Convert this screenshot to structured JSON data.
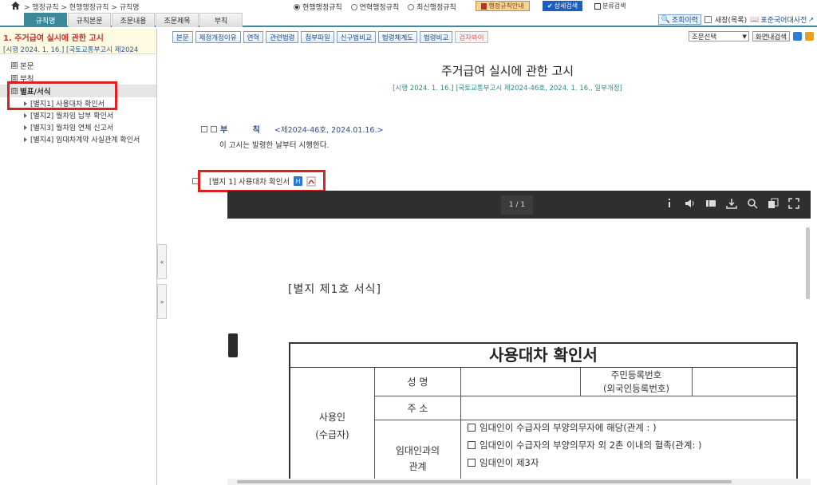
{
  "topbar": {
    "breadcrumb": "> 행정규칙 > 현행행정규칙 > 규칙명",
    "radios": [
      {
        "label": "현행행정규칙",
        "selected": true
      },
      {
        "label": "연혁행정규칙",
        "selected": false
      },
      {
        "label": "최신행정규칙",
        "selected": false
      }
    ],
    "guide_label": "행정규칙안내",
    "detail_search_label": "상세검색",
    "class_search_label": "분류검색"
  },
  "tabs": [
    "규칙명",
    "규칙본문",
    "조문내용",
    "조문제목",
    "부칙"
  ],
  "tab_right": {
    "history_label": "조회이력",
    "new_window_label": "새창(목록)",
    "dict_label": "표준국어대사전"
  },
  "left": {
    "title": "1. 주거급여 실시에 관한 고시",
    "subtitle": "[시행 2024. 1. 16.] [국토교통부고시 제2024",
    "tree": [
      {
        "icon": "⊞",
        "label": "본문"
      },
      {
        "icon": "⊞",
        "label": "부칙"
      },
      {
        "icon": "⊟",
        "label": "별표/서식"
      }
    ],
    "forms": [
      "[별지1] 사용대차 확인서",
      "[별지2] 월차임 납부 확인서",
      "[별지3] 월차임 연체 신고서",
      "[별지4] 임대차계약 사실관계 확인서"
    ]
  },
  "toolbar": {
    "buttons": [
      "본문",
      "제정개정이유",
      "연혁",
      "관련법령",
      "첨부파일",
      "신구법비교",
      "법령체계도",
      "법령비교",
      "검자봐어"
    ],
    "select_label": "조문선택",
    "search_in_label": "화면내검색"
  },
  "doc": {
    "title": "주거급여 실시에 관한 고시",
    "subtitle": "[시행 2024. 1. 16.] [국토교통부고시 제2024-46호, 2024. 1. 16., 일부개정]",
    "supplement_label": "부 칙",
    "supplement_date": "<제2024-46호, 2024.01.16.>",
    "supplement_text": "이 고시는 발령한 날부터 시행한다.",
    "attachment_label": "[별지 1] 사용대차 확인서"
  },
  "viewer": {
    "page_indicator": "1 / 1",
    "form_head": "[별지 제1호 서식]",
    "form_title": "사용대차 확인서",
    "cells": {
      "name": "성    명",
      "id": "주민등록번호\n(외국인등록번호)",
      "address": "주    소",
      "user": "사용인\n(수급자)",
      "relation": "임대인과의\n관계"
    },
    "options": [
      "임대인이 수급자의 부양의무자에 해당(관계 :        )",
      "임대인이 수급자의 부양의무자 외 2촌 이내의 혈족(관계:        )",
      "임대인이 제3자"
    ]
  },
  "colors": {
    "accent_teal": "#3a8a9c",
    "highlight_red": "#e02020",
    "link_blue": "#2a4f9a",
    "viewer_bar": "#2f2f2f"
  }
}
